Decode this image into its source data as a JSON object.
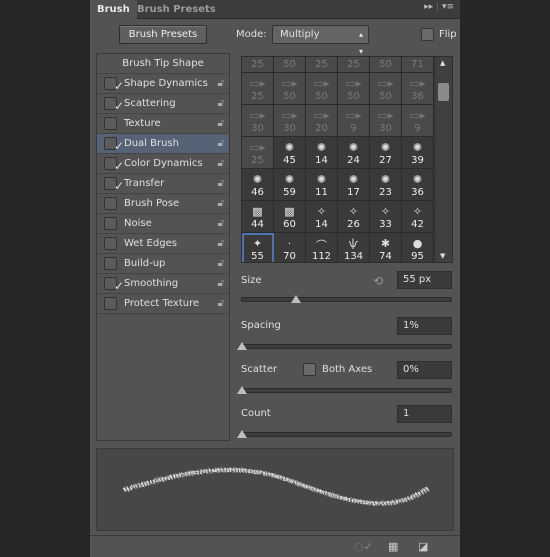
{
  "tabs": [
    {
      "label": "Brush",
      "active": true
    },
    {
      "label": "Brush Presets",
      "active": false
    }
  ],
  "panel_icons": {
    "collapse": "double-arrow-icon",
    "menu": "panel-menu-icon"
  },
  "brush_presets_button": "Brush Presets",
  "mode": {
    "label": "Mode:",
    "value": "Multiply"
  },
  "flip": {
    "label": "Flip",
    "checked": false
  },
  "options": {
    "header": "Brush Tip Shape",
    "items": [
      {
        "label": "Shape Dynamics",
        "checked": true
      },
      {
        "label": "Scattering",
        "checked": true
      },
      {
        "label": "Texture",
        "checked": false
      },
      {
        "label": "Dual Brush",
        "checked": true,
        "selected": true
      },
      {
        "label": "Color Dynamics",
        "checked": true
      },
      {
        "label": "Transfer",
        "checked": true
      },
      {
        "label": "Brush Pose",
        "checked": false
      },
      {
        "label": "Noise",
        "checked": false
      },
      {
        "label": "Wet Edges",
        "checked": false
      },
      {
        "label": "Build-up",
        "checked": false
      },
      {
        "label": "Smoothing",
        "checked": true
      },
      {
        "label": "Protect Texture",
        "checked": false
      }
    ]
  },
  "brush_grid": [
    [
      "25",
      "50",
      "25",
      "25",
      "50",
      "71"
    ],
    [
      "25",
      "50",
      "50",
      "50",
      "50",
      "36"
    ],
    [
      "30",
      "30",
      "20",
      "9",
      "30",
      "9"
    ],
    [
      "25",
      "45",
      "14",
      "24",
      "27",
      "39"
    ],
    [
      "46",
      "59",
      "11",
      "17",
      "23",
      "36"
    ],
    [
      "44",
      "60",
      "14",
      "26",
      "33",
      "42"
    ],
    [
      "55",
      "70",
      "112",
      "134",
      "74",
      "95"
    ]
  ],
  "selected_brush": "55",
  "size": {
    "label": "Size",
    "value": "55 px",
    "slider_percent": 27
  },
  "spacing": {
    "label": "Spacing",
    "value": "1%",
    "slider_percent": 0
  },
  "scatter": {
    "label": "Scatter",
    "value": "0%",
    "slider_percent": 0,
    "both_axes_label": "Both Axes",
    "both_axes_checked": false
  },
  "count": {
    "label": "Count",
    "value": "1",
    "slider_percent": 0
  },
  "accent": "#4d72b0"
}
